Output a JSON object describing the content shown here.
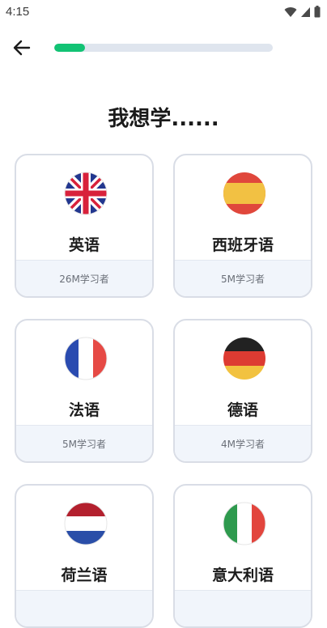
{
  "status_bar": {
    "time": "4:15",
    "icons": [
      "wifi-icon",
      "signal-icon",
      "battery-icon"
    ]
  },
  "header": {
    "back_icon": "arrow-left-icon",
    "progress_fraction": 0.14,
    "progress_color": "#12c374",
    "track_color": "#dfe5ee"
  },
  "title": "我想学......",
  "languages": [
    {
      "name": "英语",
      "learners": "26M学习者",
      "flag_icon": "uk-flag-icon"
    },
    {
      "name": "西班牙语",
      "learners": "5M学习者",
      "flag_icon": "spain-flag-icon"
    },
    {
      "name": "法语",
      "learners": "5M学习者",
      "flag_icon": "france-flag-icon"
    },
    {
      "name": "德语",
      "learners": "4M学习者",
      "flag_icon": "germany-flag-icon"
    },
    {
      "name": "荷兰语",
      "learners": "",
      "flag_icon": "netherlands-flag-icon"
    },
    {
      "name": "意大利语",
      "learners": "",
      "flag_icon": "italy-flag-icon"
    }
  ]
}
